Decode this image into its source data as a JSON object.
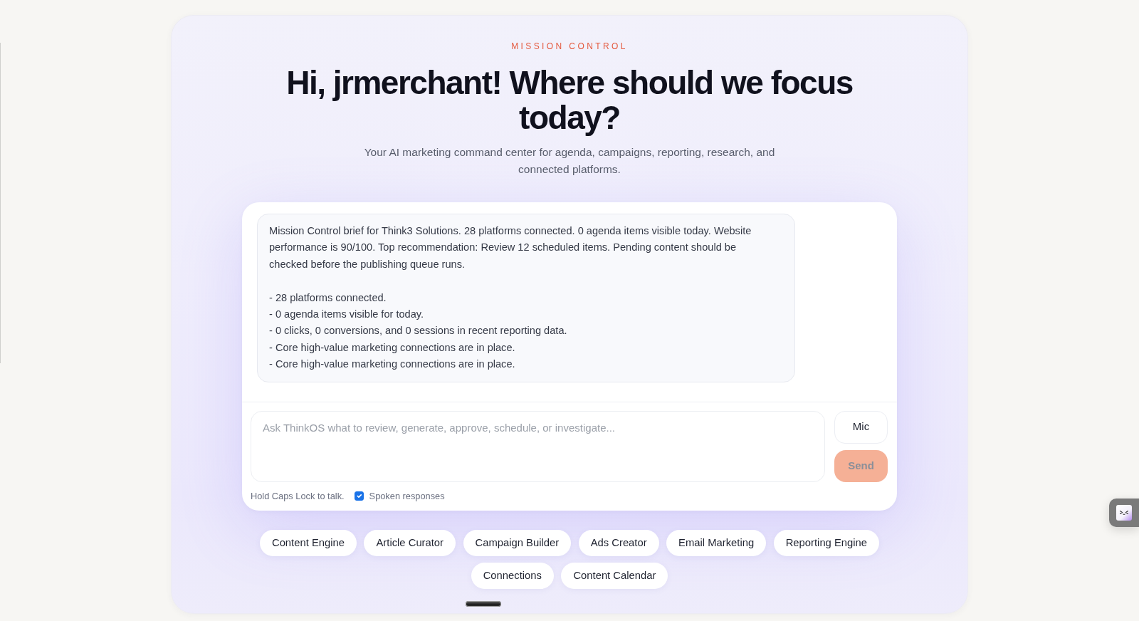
{
  "header": {
    "eyebrow": "MISSION CONTROL",
    "title": "Hi, jrmerchant! Where should we focus today?",
    "subtitle": "Your AI marketing command center for agenda, campaigns, reporting, research, and connected platforms."
  },
  "brief": {
    "summary": "Mission Control brief for Think3 Solutions. 28 platforms connected. 0 agenda items visible today. Website performance is 90/100. Top recommendation: Review 12 scheduled items. Pending content should be checked before the publishing queue runs.",
    "lines": [
      "- 28 platforms connected.",
      "- 0 agenda items visible for today.",
      "- 0 clicks, 0 conversions, and 0 sessions in recent reporting data.",
      "- Core high-value marketing connections are in place.",
      "- Core high-value marketing connections are in place."
    ]
  },
  "composer": {
    "placeholder": "Ask ThinkOS what to review, generate, approve, schedule, or investigate...",
    "mic_button": "Mic",
    "send_button": {
      "label": "Send",
      "disabled": true
    },
    "hint": "Hold Caps Lock to talk.",
    "spoken_responses": {
      "label": "Spoken responses",
      "checked": true
    }
  },
  "shortcuts": [
    {
      "label": "Content Engine"
    },
    {
      "label": "Article Curator"
    },
    {
      "label": "Campaign Builder"
    },
    {
      "label": "Ads Creator"
    },
    {
      "label": "Email Marketing"
    },
    {
      "label": "Reporting Engine"
    },
    {
      "label": "Connections"
    },
    {
      "label": "Content Calendar"
    }
  ]
}
